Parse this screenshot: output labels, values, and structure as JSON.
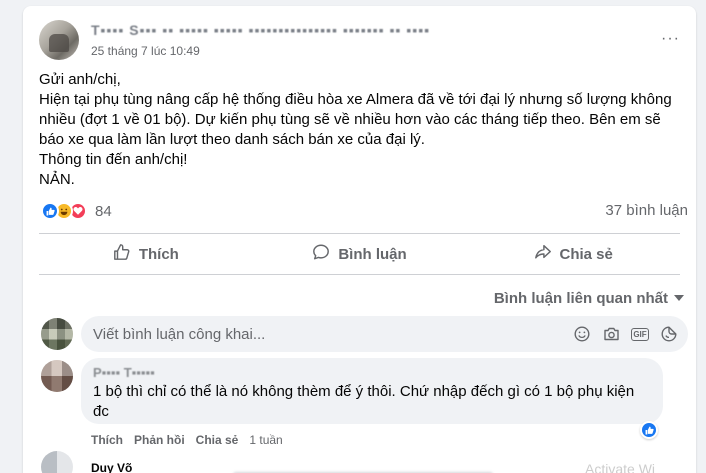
{
  "post": {
    "author_name": "T▪▪▪▪ S▪▪▪ ▪▪ ▪▪▪▪▪ ▪▪▪▪▪ ▪▪▪▪▪▪▪▪▪▪▪▪▪▪▪ ▪▪▪▪▪▪▪ ▪▪ ▪▪▪▪",
    "time": "25 tháng 7 lúc 10:49",
    "more_label": "···",
    "body_lines": [
      "Gửi anh/chị,",
      "Hiện tại phụ tùng nâng cấp hệ thống điều hòa xe Almera đã về tới đại lý nhưng số lượng không nhiều (đợt 1 về 01 bộ). Dự kiến phụ tùng sẽ về nhiều hơn vào các tháng tiếp theo. Bên em sẽ báo xe qua làm lần lượt theo danh sách bán xe của đại lý.",
      "Thông tin đến anh/chị!",
      "NẢN."
    ],
    "reaction_count": "84",
    "comment_count": "37 bình luận"
  },
  "actions": {
    "like": "Thích",
    "comment": "Bình luận",
    "share": "Chia sẻ"
  },
  "comments": {
    "sort_label": "Bình luận liên quan nhất",
    "composer_placeholder": "Viết bình luận công khai...",
    "composer_icons": [
      "smile-icon",
      "camera-icon",
      "gif-icon",
      "sticker-icon"
    ],
    "first": {
      "author_name": "P▪▪▪▪ T▪▪▪▪▪",
      "text": "1 bộ thì chỉ có thể là nó không thèm để ý thôi. Chứ nhập đếch gì có 1 bộ phụ kiện đc",
      "like_label": "Thích",
      "reply_label": "Phản hồi",
      "share_label": "Chia sẻ",
      "time": "1 tuần"
    },
    "second": {
      "author_name": "Duy Võ"
    }
  },
  "watermark": "Activate Wi",
  "colors": {
    "accent": "#1877f2",
    "love": "#f33e58",
    "haha": "#f7b928",
    "secondary_text": "#65676b"
  }
}
